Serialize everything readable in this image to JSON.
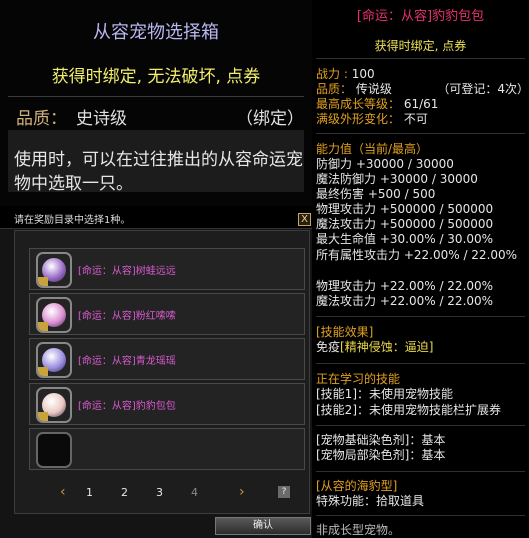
{
  "left_tooltip": {
    "title": "从容宠物选择箱",
    "bind_notice": "获得时绑定, 无法破坏, 点券",
    "grade_label": "品质：",
    "grade_value": "史诗级",
    "bind_tag": "（绑定）",
    "description": "使用时，可以在过往推出的从容命运宠物中选取一只。"
  },
  "dialog": {
    "prompt": "请在奖励目录中选择1种。",
    "close_glyph": "X",
    "rewards": [
      {
        "name": "[命运：从容]树蛙远远",
        "orb_color": "#9a6cc8"
      },
      {
        "name": "[命运：从容]粉红嗦嗦",
        "orb_color": "#d98fd0"
      },
      {
        "name": "[命运：从容]青龙瑶瑶",
        "orb_color": "#9a8ee0"
      },
      {
        "name": "[命运：从容]豹豹包包",
        "orb_color": "#e8c8c0"
      }
    ],
    "pages": [
      "1",
      "2",
      "3",
      "4"
    ],
    "prev_glyph": "‹",
    "next_glyph": "›",
    "help_glyph": "?",
    "confirm_label": "确认"
  },
  "right_tooltip": {
    "title": "[命运：从容]豹豹包包",
    "bind_notice": "获得时绑定, 点券",
    "power_label": "战力 : ",
    "power_value": "100",
    "grade_label": "品质： ",
    "grade_value": "传说级",
    "register_value": "（可登记：4次）",
    "maxlv_label": "最高成长等级： ",
    "maxlv_value": "61/61",
    "appearance_label": "满级外形变化： ",
    "appearance_value": "不可",
    "ability_header": "能力值（当前/最高）",
    "stats": [
      "防御力 +30000 / 30000",
      "魔法防御力 +30000 / 30000",
      "最终伤害 +500 / 500",
      "物理攻击力 +500000 / 500000",
      "魔法攻击力 +500000 / 500000",
      "最大生命值 +30.00% / 30.00%",
      "所有属性攻击力 +22.00% / 22.00%"
    ],
    "stats2": [
      "物理攻击力 +22.00% / 22.00%",
      "魔法攻击力 +22.00% / 22.00%"
    ],
    "skill_effect_header": "[技能效果]",
    "immune_prefix": "免疫",
    "immune_value": "[精神侵蚀：逼迫]",
    "learning_header": "正在学习的技能",
    "skill_lines": [
      "[技能1]：未使用宠物技能",
      "[技能2]：未使用宠物技能栏扩展券"
    ],
    "dye_lines": [
      "[宠物基础染色剂]：基本",
      "[宠物局部染色剂]：基本"
    ],
    "type_header": "[从容的海豹型]",
    "special_label": "特殊功能：",
    "special_value": "拾取道具",
    "footer": "非成长型宠物。"
  }
}
